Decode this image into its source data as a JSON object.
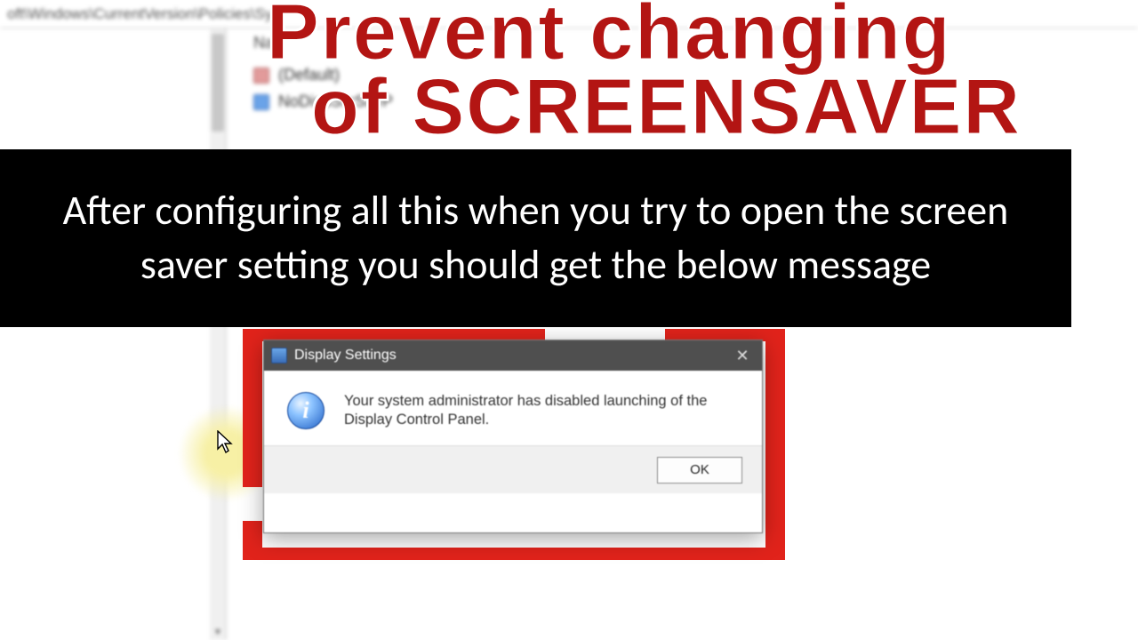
{
  "headline": {
    "line1": "Prevent changing",
    "line2": "of SCREENSAVER"
  },
  "caption": "After configuring all this when you try to open the screen saver setting you should get the below message",
  "registry": {
    "address": "oft\\Windows\\CurrentVersion\\Policies\\Sy",
    "column_header": "Na",
    "rows": [
      {
        "name": "(Default)"
      },
      {
        "name": "NoDispScrSavP"
      }
    ]
  },
  "dialog": {
    "title": "Display Settings",
    "message": "Your system administrator has disabled launching of the Display Control Panel.",
    "ok_label": "OK",
    "close_glyph": "✕"
  },
  "colors": {
    "accent_red": "#e1231b",
    "headline_red": "#b31513"
  }
}
